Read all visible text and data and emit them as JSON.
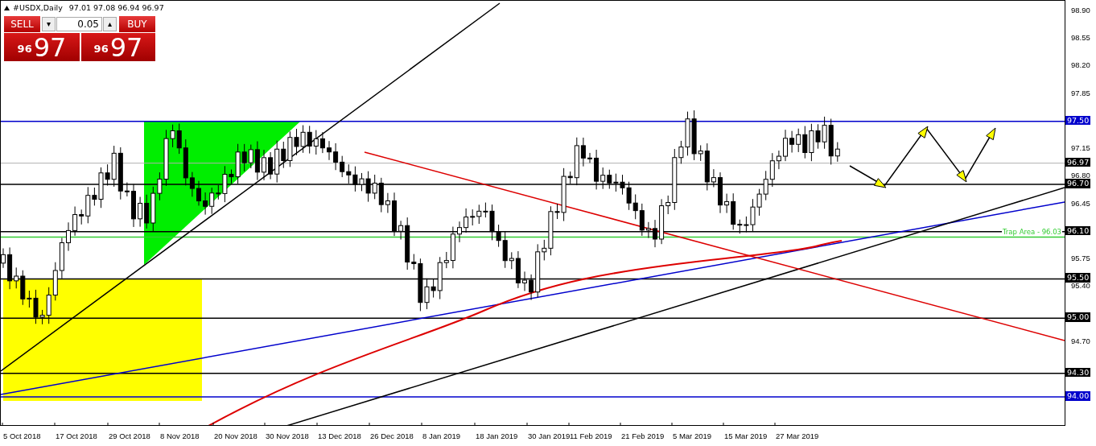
{
  "header": {
    "symbol": "#USDX,Daily",
    "ohlc": "97.01 97.08 96.94 96.97"
  },
  "trade_panel": {
    "sell_label": "SELL",
    "buy_label": "BUY",
    "lot_value": "0.05",
    "down_arrow": "▾",
    "up_arrow": "▴",
    "sell_price": {
      "small": "96",
      "big": "97"
    },
    "buy_price": {
      "small": "96",
      "big": "97"
    }
  },
  "price_axis": [
    "98.90",
    "98.55",
    "98.20",
    "97.85",
    "97.15",
    "96.80",
    "96.45",
    "95.75",
    "95.40",
    "94.70"
  ],
  "price_markers": [
    {
      "label": "97.50",
      "color": "#0000cc"
    },
    {
      "label": "96.97",
      "color": "#000000"
    },
    {
      "label": "96.70",
      "color": "#000000"
    },
    {
      "label": "96.10",
      "color": "#000000"
    },
    {
      "label": "95.50",
      "color": "#000000"
    },
    {
      "label": "95.00",
      "color": "#000000"
    },
    {
      "label": "94.30",
      "color": "#000000"
    },
    {
      "label": "94.00",
      "color": "#0000cc"
    }
  ],
  "trap_label": "Trap Area - 96.03",
  "date_axis": [
    "5 Oct 2018",
    "17 Oct 2018",
    "29 Oct 2018",
    "8 Nov 2018",
    "20 Nov 2018",
    "30 Nov 2018",
    "13 Dec 2018",
    "26 Dec 2018",
    "8 Jan 2019",
    "18 Jan 2019",
    "30 Jan 2019",
    "11 Feb 2019",
    "21 Feb 2019",
    "5 Mar 2019",
    "15 Mar 2019",
    "27 Mar 2019"
  ]
}
